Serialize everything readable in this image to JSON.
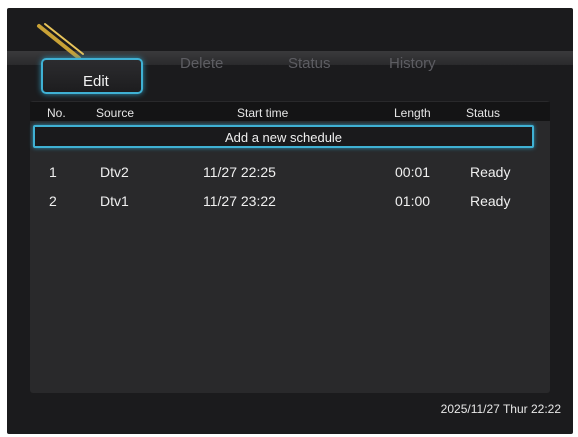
{
  "tabs": {
    "edit": "Edit",
    "delete": "Delete",
    "status": "Status",
    "history": "History"
  },
  "table": {
    "headers": [
      "No.",
      "Source",
      "Start time",
      "Length",
      "Status"
    ],
    "add_row_label": "Add a new schedule",
    "rows": [
      {
        "no": "1",
        "source": "Dtv2",
        "start": "11/27 22:25",
        "length": "00:01",
        "status": "Ready"
      },
      {
        "no": "2",
        "source": "Dtv1",
        "start": "11/27 23:22",
        "length": "01:00",
        "status": "Ready"
      }
    ]
  },
  "footer": {
    "datetime": "2025/11/27 Thur 22:22"
  },
  "colors": {
    "accent": "#3fb1d4",
    "background": "#1b1b1d",
    "panel": "#29292b"
  },
  "icons": {
    "logo": "pencil-logo-icon"
  }
}
